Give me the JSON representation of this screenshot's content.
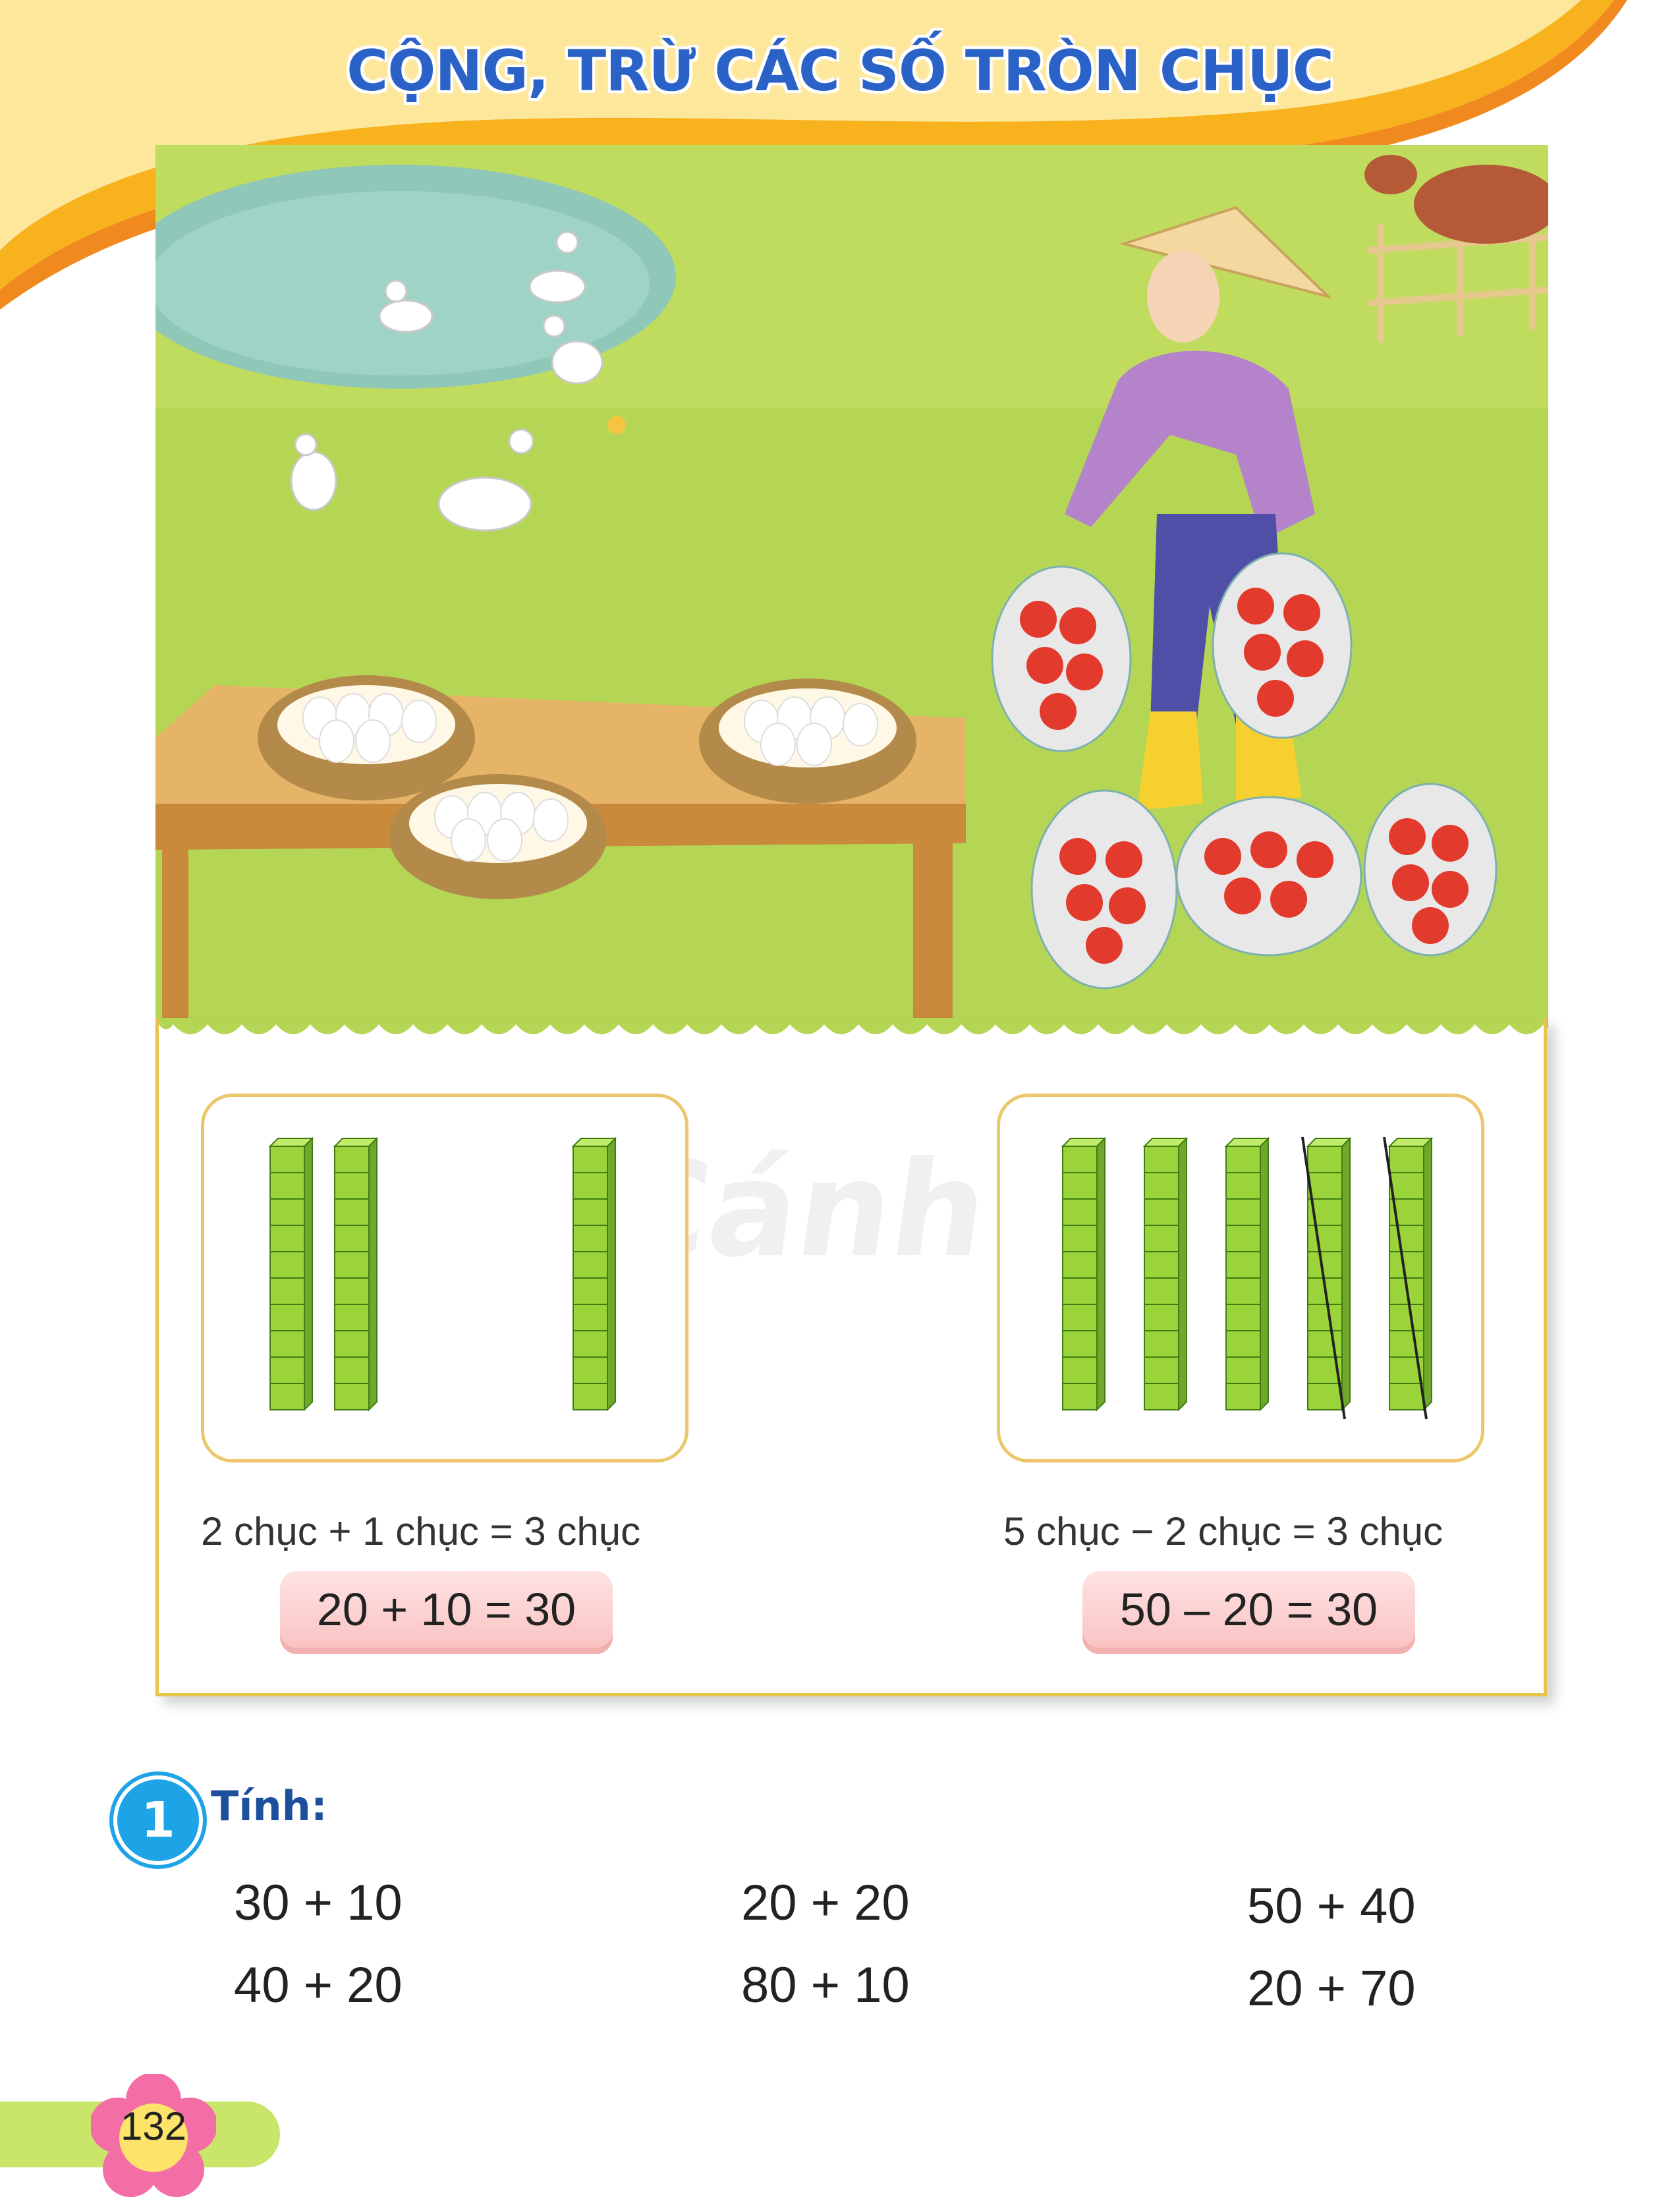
{
  "header": {
    "title": "CỘNG, TRỪ CÁC SỐ TRÒN CHỤC"
  },
  "example_left": {
    "text": "2 chục + 1 chục = 3 chục",
    "equation": "20 + 10 = 30",
    "rods_group1": 2,
    "rods_group2": 1
  },
  "example_right": {
    "text": "5 chục − 2 chục = 3 chục",
    "equation": "50 – 20 = 30",
    "rods": 5,
    "crossed_out": 2
  },
  "exercise": {
    "number": "1",
    "label": "Tính:",
    "items": [
      "30 + 10",
      "40 + 20",
      "20 + 20",
      "80 + 10",
      "50 + 40",
      "20 + 70"
    ]
  },
  "watermark": "Cánh Diều",
  "page_number": "132"
}
